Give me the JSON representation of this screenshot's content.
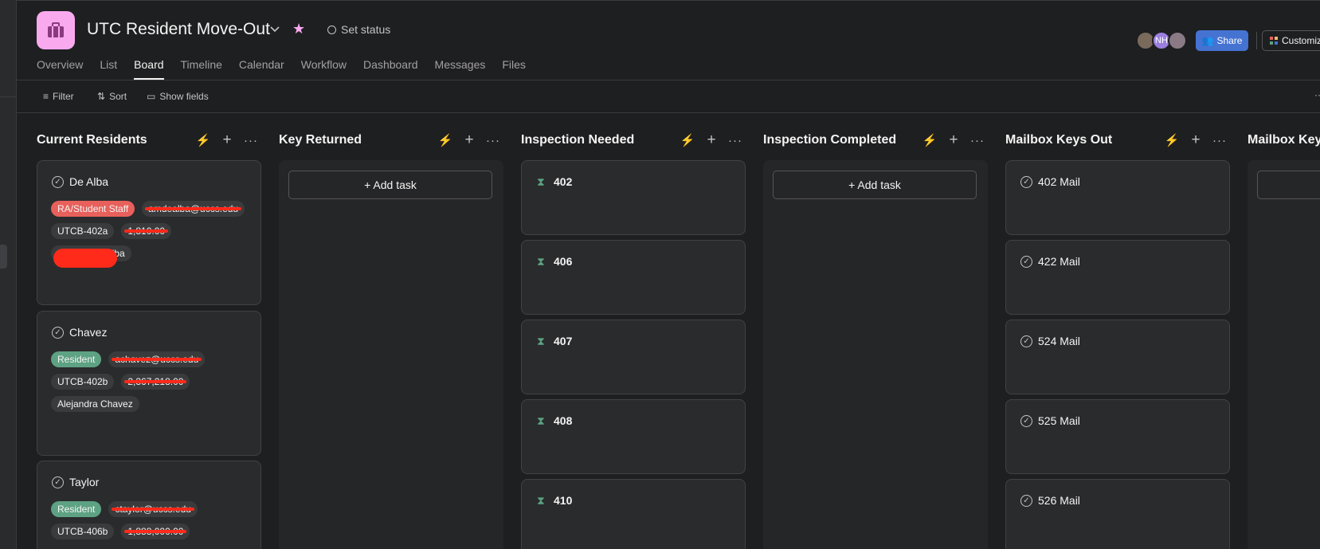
{
  "project": {
    "title": "UTC Resident Move-Out",
    "set_status": "Set status",
    "icon": "briefcase-icon",
    "icon_color": "#f9aaef"
  },
  "tabs": [
    "Overview",
    "List",
    "Board",
    "Timeline",
    "Calendar",
    "Workflow",
    "Dashboard",
    "Messages",
    "Files"
  ],
  "active_tab": "Board",
  "header_right": {
    "avatar_initials": "NH",
    "share_label": "Share",
    "customize_label": "Customiz"
  },
  "toolbar": {
    "filter": "Filter",
    "sort": "Sort",
    "show_fields": "Show fields"
  },
  "add_task_label": "+ Add task",
  "colors": {
    "ra_tag": "#e8605b",
    "resident_tag": "#5da283",
    "accent_blue": "#4573d2",
    "bolt": "#f1bd6c"
  },
  "columns": [
    {
      "title": "Current Residents",
      "cards": [
        {
          "title": "De Alba",
          "tags": [
            "RA/Student Staff",
            "amdealba@uccs.edu",
            "UTCB-402a",
            "1,810.00",
            "Montse De Alba"
          ]
        },
        {
          "title": "Chavez",
          "tags": [
            "Resident",
            "achavez@uccs.edu",
            "UTCB-402b",
            "2,367,218.00",
            "Alejandra Chavez"
          ]
        },
        {
          "title": "Taylor",
          "tags": [
            "Resident",
            "ctaylor@uccs.edu",
            "UTCB-406b",
            "1,888,000.00"
          ]
        }
      ]
    },
    {
      "title": "Key Returned",
      "cards": []
    },
    {
      "title": "Inspection Needed",
      "cards": [
        {
          "title": "402"
        },
        {
          "title": "406"
        },
        {
          "title": "407"
        },
        {
          "title": "408"
        },
        {
          "title": "410"
        }
      ]
    },
    {
      "title": "Inspection Completed",
      "cards": []
    },
    {
      "title": "Mailbox Keys Out",
      "cards": [
        {
          "title": "402 Mail"
        },
        {
          "title": "422 Mail"
        },
        {
          "title": "524 Mail"
        },
        {
          "title": "525 Mail"
        },
        {
          "title": "526 Mail"
        }
      ]
    },
    {
      "title": "Mailbox Keys",
      "cards": []
    }
  ]
}
